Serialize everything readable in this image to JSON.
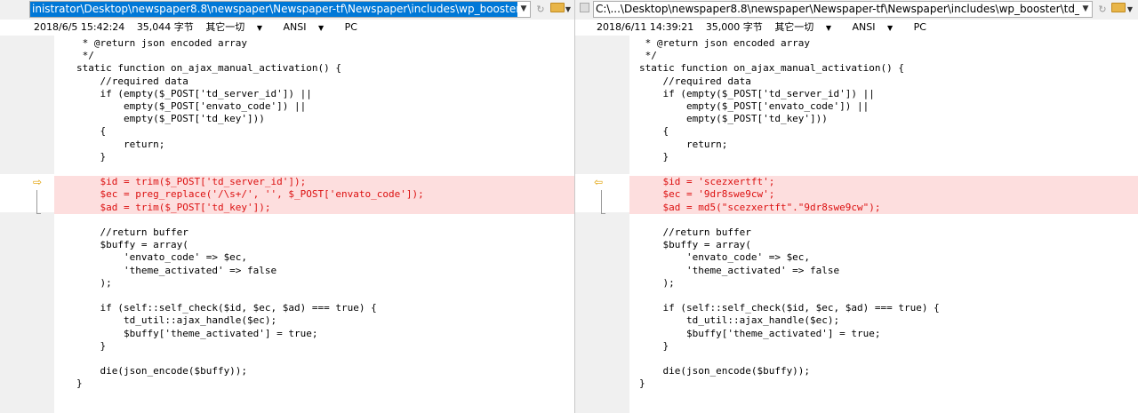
{
  "left": {
    "path": "inistrator\\Desktop\\newspaper8.8\\newspaper\\Newspaper-tf\\Newspaper\\includes\\wp_booster\\td_ajax.bak.php",
    "info": {
      "timestamp": "2018/6/5 15:42:24",
      "size": "35,044 字节",
      "encoding_option": "其它一切",
      "charset": "ANSI",
      "line_ending": "PC"
    },
    "lines": [
      " * @return json encoded array",
      " */",
      "static function on_ajax_manual_activation() {",
      "    //required data",
      "    if (empty($_POST['td_server_id']) ||",
      "        empty($_POST['envato_code']) ||",
      "        empty($_POST['td_key']))",
      "    {",
      "        return;",
      "    }",
      "",
      "    $id = trim($_POST['td_server_id']);",
      "    $ec = preg_replace('/\\s+/', '', $_POST['envato_code']);",
      "    $ad = trim($_POST['td_key']);",
      "",
      "    //return buffer",
      "    $buffy = array(",
      "        'envato_code' => $ec,",
      "        'theme_activated' => false",
      "    );",
      "",
      "    if (self::self_check($id, $ec, $ad) === true) {",
      "        td_util::ajax_handle($ec);",
      "        $buffy['theme_activated'] = true;",
      "    }",
      "",
      "    die(json_encode($buffy));",
      "}"
    ]
  },
  "right": {
    "path": "C:\\...\\Desktop\\newspaper8.8\\newspaper\\Newspaper-tf\\Newspaper\\includes\\wp_booster\\td_ajax.php",
    "info": {
      "timestamp": "2018/6/11 14:39:21",
      "size": "35,000 字节",
      "encoding_option": "其它一切",
      "charset": "ANSI",
      "line_ending": "PC"
    },
    "lines": [
      " * @return json encoded array",
      " */",
      "static function on_ajax_manual_activation() {",
      "    //required data",
      "    if (empty($_POST['td_server_id']) ||",
      "        empty($_POST['envato_code']) ||",
      "        empty($_POST['td_key']))",
      "    {",
      "        return;",
      "    }",
      "",
      "    $id = 'scezxertft';",
      "    $ec = '9dr8swe9cw';",
      "    $ad = md5(\"scezxertft\".\"9dr8swe9cw\");",
      "",
      "    //return buffer",
      "    $buffy = array(",
      "        'envato_code' => $ec,",
      "        'theme_activated' => false",
      "    );",
      "",
      "    if (self::self_check($id, $ec, $ad) === true) {",
      "        td_util::ajax_handle($ec);",
      "        $buffy['theme_activated'] = true;",
      "    }",
      "",
      "    die(json_encode($buffy));",
      "}"
    ]
  },
  "diff_lines": [
    11,
    12,
    13
  ],
  "colors": {
    "diff_bg": "#fddede",
    "diff_text": "#dc1010",
    "arrow": "#e0a000",
    "selection": "#0078d7"
  }
}
